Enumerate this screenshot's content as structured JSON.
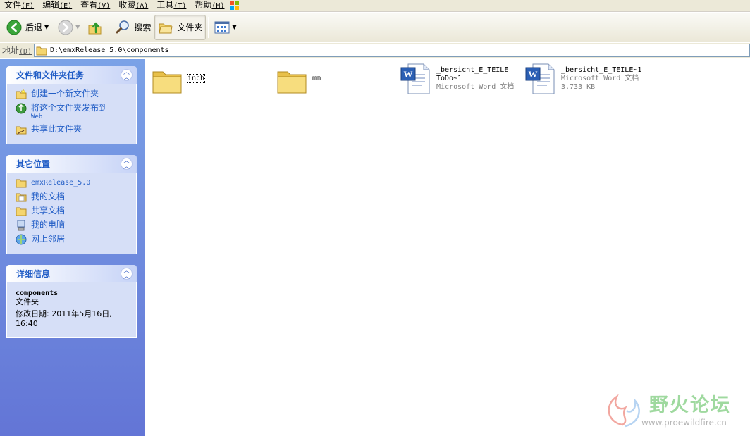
{
  "menu": [
    {
      "label": "文件",
      "accel": "(F)"
    },
    {
      "label": "编辑",
      "accel": "(E)"
    },
    {
      "label": "查看",
      "accel": "(V)"
    },
    {
      "label": "收藏",
      "accel": "(A)"
    },
    {
      "label": "工具",
      "accel": "(T)"
    },
    {
      "label": "帮助",
      "accel": "(H)"
    }
  ],
  "toolbar": {
    "back_label": "后退",
    "search_label": "搜索",
    "folders_label": "文件夹"
  },
  "address": {
    "label": "地址",
    "accel": "(D)",
    "path": "D:\\emxRelease_5.0\\components"
  },
  "panels": {
    "tasks": {
      "title": "文件和文件夹任务",
      "items": [
        {
          "label": "创建一个新文件夹",
          "icon": "new-folder-icon"
        },
        {
          "label": "将这个文件夹发布到",
          "sub": "Web",
          "icon": "publish-web-icon"
        },
        {
          "label": "共享此文件夹",
          "icon": "share-folder-icon"
        }
      ]
    },
    "places": {
      "title": "其它位置",
      "items": [
        {
          "label": "emxRelease_5.0",
          "icon": "folder-icon"
        },
        {
          "label": "我的文档",
          "icon": "my-documents-icon"
        },
        {
          "label": "共享文档",
          "icon": "shared-documents-icon"
        },
        {
          "label": "我的电脑",
          "icon": "my-computer-icon"
        },
        {
          "label": "网上邻居",
          "icon": "network-places-icon"
        }
      ]
    },
    "details": {
      "title": "详细信息",
      "name": "components",
      "type": "文件夹",
      "modified_line1": "修改日期: 2011年5月16日,",
      "modified_line2": "16:40"
    }
  },
  "files": [
    {
      "name": "inch",
      "kind": "folder"
    },
    {
      "name": "mm",
      "kind": "folder"
    },
    {
      "name_line1": "_bersicht_E_TEILE",
      "name_line2": "ToDo~1",
      "type": "Microsoft Word 文档",
      "kind": "word"
    },
    {
      "name_line1": "_bersicht_E_TEILE~1",
      "type": "Microsoft Word 文档",
      "size": "3,733 KB",
      "kind": "word"
    }
  ],
  "watermark": {
    "title": "野火论坛",
    "url": "www.proewildfire.cn"
  },
  "colors": {
    "xp_blue_link": "#215dc6",
    "left_pane_top": "#7ba2e7",
    "left_pane_bottom": "#6375d6",
    "chrome": "#ece9d8"
  }
}
